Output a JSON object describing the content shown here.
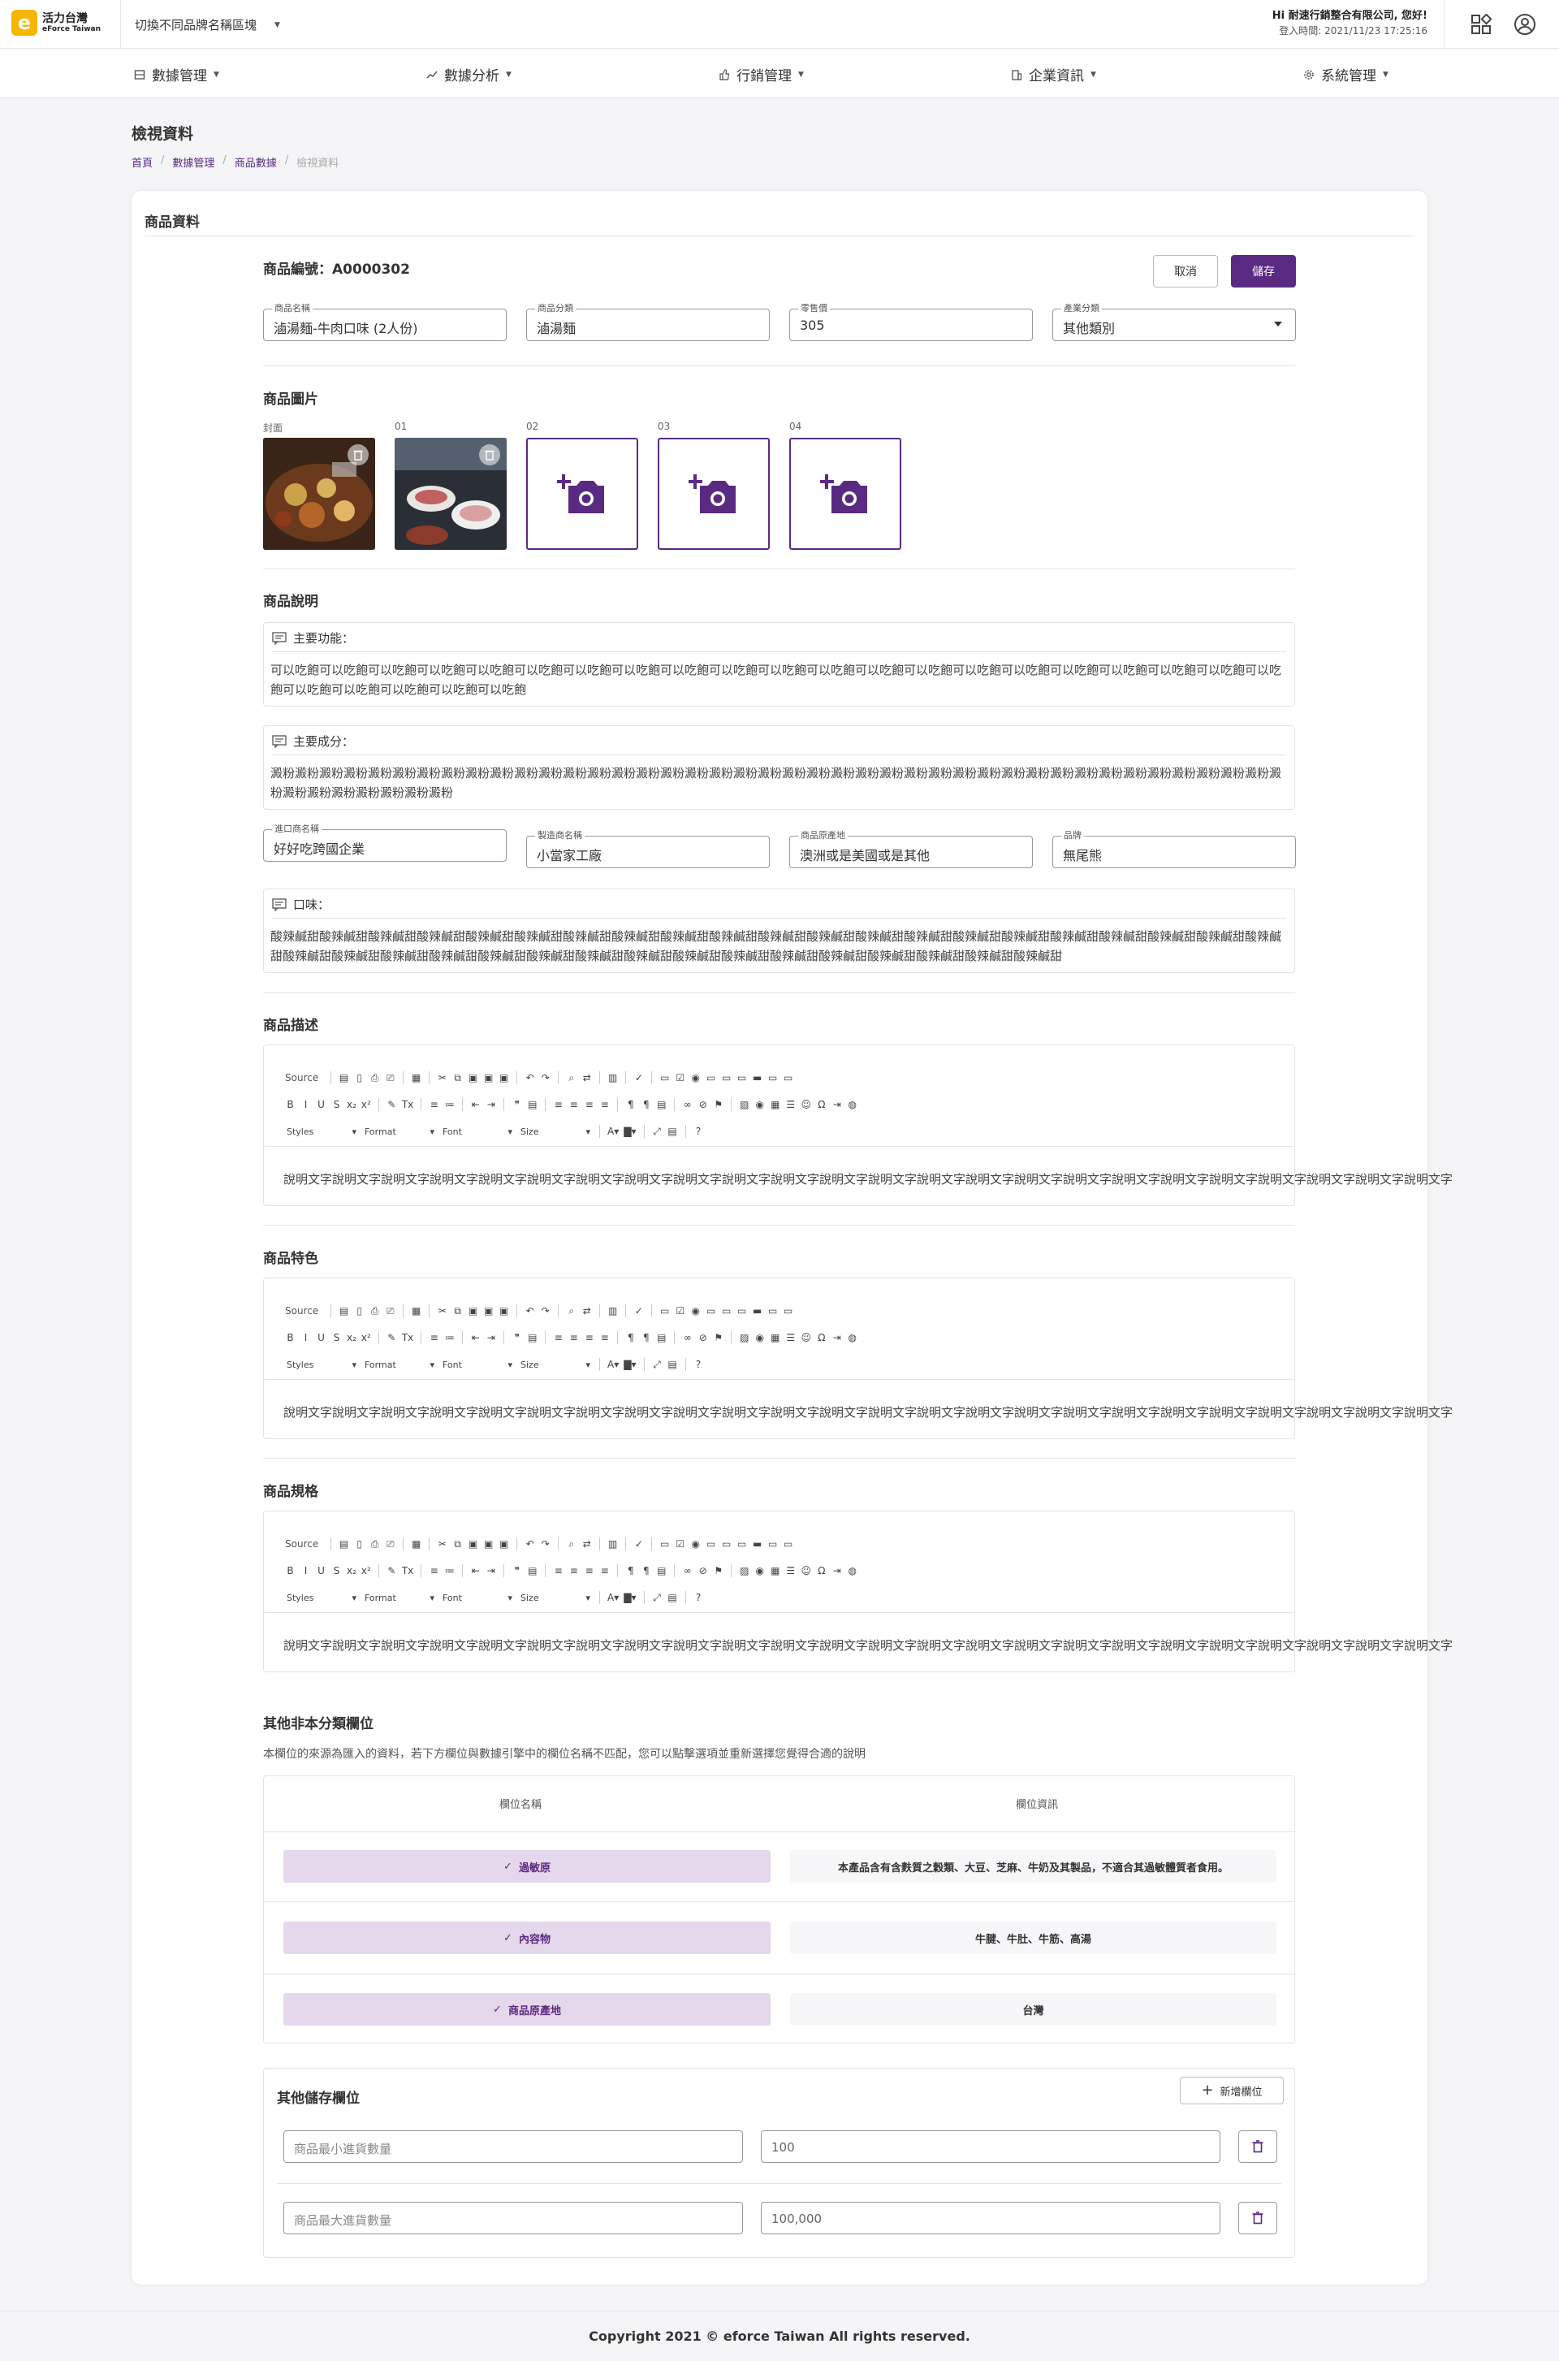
{
  "app": {
    "logo_title": "活力台灣",
    "logo_sub": "eForce Taiwan",
    "brand_switch": "切換不同品牌名稱區塊",
    "accent": "#5a2a82"
  },
  "user": {
    "greeting": "Hi 耐速行銷整合有限公司, 您好!",
    "login_time": "登入時間:  2021/11/23 17:25:16"
  },
  "nav": [
    {
      "label": "數據管理",
      "icon": "database-icon"
    },
    {
      "label": "數據分析",
      "icon": "trend-chart-icon"
    },
    {
      "label": "行銷管理",
      "icon": "thumbs-up-icon"
    },
    {
      "label": "企業資訊",
      "icon": "building-icon"
    },
    {
      "label": "系統管理",
      "icon": "gear-icon"
    }
  ],
  "page": {
    "title": "檢視資料",
    "breadcrumb": [
      "首頁",
      "數據管理",
      "商品數據",
      "檢視資料"
    ]
  },
  "card": {
    "title": "商品資料"
  },
  "product": {
    "code_label": "商品編號：A0000302",
    "cancel_label": "取消",
    "save_label": "儲存",
    "fields": [
      {
        "label": "商品名稱",
        "value": "滷湯麵-牛肉口味 (2人份)"
      },
      {
        "label": "商品分類",
        "value": "滷湯麵"
      },
      {
        "label": "零售價",
        "value": "305"
      },
      {
        "label": "產業分類",
        "value": "其他類別"
      }
    ]
  },
  "images": {
    "title": "商品圖片",
    "slots": [
      "封面",
      "01",
      "02",
      "03",
      "04"
    ]
  },
  "description": {
    "title": "商品說明",
    "main_function": {
      "label": "主要功能：",
      "text": "可以吃飽可以吃飽可以吃飽可以吃飽可以吃飽可以吃飽可以吃飽可以吃飽可以吃飽可以吃飽可以吃飽可以吃飽可以吃飽可以吃飽可以吃飽可以吃飽可以吃飽可以吃飽可以吃飽可以吃飽可以吃飽可以吃飽可以吃飽可以吃飽可以吃飽可以吃飽"
    },
    "ingredients": {
      "label": "主要成分：",
      "text": "澱粉澱粉澱粉澱粉澱粉澱粉澱粉澱粉澱粉澱粉澱粉澱粉澱粉澱粉澱粉澱粉澱粉澱粉澱粉澱粉澱粉澱粉澱粉澱粉澱粉澱粉澱粉澱粉澱粉澱粉澱粉澱粉澱粉澱粉澱粉澱粉澱粉澱粉澱粉澱粉澱粉澱粉澱粉澱粉澱粉澱粉澱粉澱粉澱粉"
    },
    "fields": [
      {
        "label": "進口商名稱",
        "value": "好好吃跨國企業"
      },
      {
        "label": "製造商名稱",
        "value": "小當家工廠"
      },
      {
        "label": "商品原產地",
        "value": "澳洲或是美國或是其他"
      },
      {
        "label": "品牌",
        "value": "無尾熊"
      }
    ],
    "flavor": {
      "label": "口味：",
      "text": "酸辣鹹甜酸辣鹹甜酸辣鹹甜酸辣鹹甜酸辣鹹甜酸辣鹹甜酸辣鹹甜酸辣鹹甜酸辣鹹甜酸辣鹹甜酸辣鹹甜酸辣鹹甜酸辣鹹甜酸辣鹹甜酸辣鹹甜酸辣鹹甜酸辣鹹甜酸辣鹹甜酸辣鹹甜酸辣鹹甜酸辣鹹甜酸辣鹹甜酸辣鹹甜酸辣鹹甜酸辣鹹甜酸辣鹹甜酸辣鹹甜酸辣鹹甜酸辣鹹甜酸辣鹹甜酸辣鹹甜酸辣鹹甜酸辣鹹甜酸辣鹹甜酸辣鹹甜酸辣鹹甜酸辣鹹甜"
    }
  },
  "editor_toolbar": {
    "source": "Source",
    "styles": "Styles",
    "format": "Format",
    "font": "Font",
    "size": "Size"
  },
  "editors": [
    {
      "title": "商品描述",
      "content": "說明文字說明文字說明文字說明文字說明文字說明文字說明文字說明文字說明文字說明文字說明文字說明文字說明文字說明文字說明文字說明文字說明文字說明文字說明文字說明文字說明文字說明文字說明文字說明文字"
    },
    {
      "title": "商品特色",
      "content": "說明文字說明文字說明文字說明文字說明文字說明文字說明文字說明文字說明文字說明文字說明文字說明文字說明文字說明文字說明文字說明文字說明文字說明文字說明文字說明文字說明文字說明文字說明文字說明文字"
    },
    {
      "title": "商品規格",
      "content": "說明文字說明文字說明文字說明文字說明文字說明文字說明文字說明文字說明文字說明文字說明文字說明文字說明文字說明文字說明文字說明文字說明文字說明文字說明文字說明文字說明文字說明文字說明文字說明文字"
    }
  ],
  "other_fields": {
    "title": "其他非本分類欄位",
    "subtitle": "本欄位的來源為匯入的資料，若下方欄位與數據引擎中的欄位名稱不匹配，您可以點擊選項並重新選擇您覺得合適的說明",
    "col_name": "欄位名稱",
    "col_info": "欄位資訊",
    "rows": [
      {
        "name": "過敏原",
        "info": "本產品含有含麩質之穀類、大豆、芝麻、牛奶及其製品，不適合其過敏體質者食用。"
      },
      {
        "name": "內容物",
        "info": "牛腱、牛肚、牛筋、高湯"
      },
      {
        "name": "商品原產地",
        "info": "台灣"
      }
    ]
  },
  "extra_storage": {
    "title": "其他儲存欄位",
    "add_label": "新增欄位",
    "rows": [
      {
        "key_placeholder": "商品最小進貨數量",
        "value": "100"
      },
      {
        "key_placeholder": "商品最大進貨數量",
        "value": "100,000"
      }
    ]
  },
  "footer": {
    "copyright": "Copyright 2021 © eforce Taiwan All rights reserved."
  }
}
